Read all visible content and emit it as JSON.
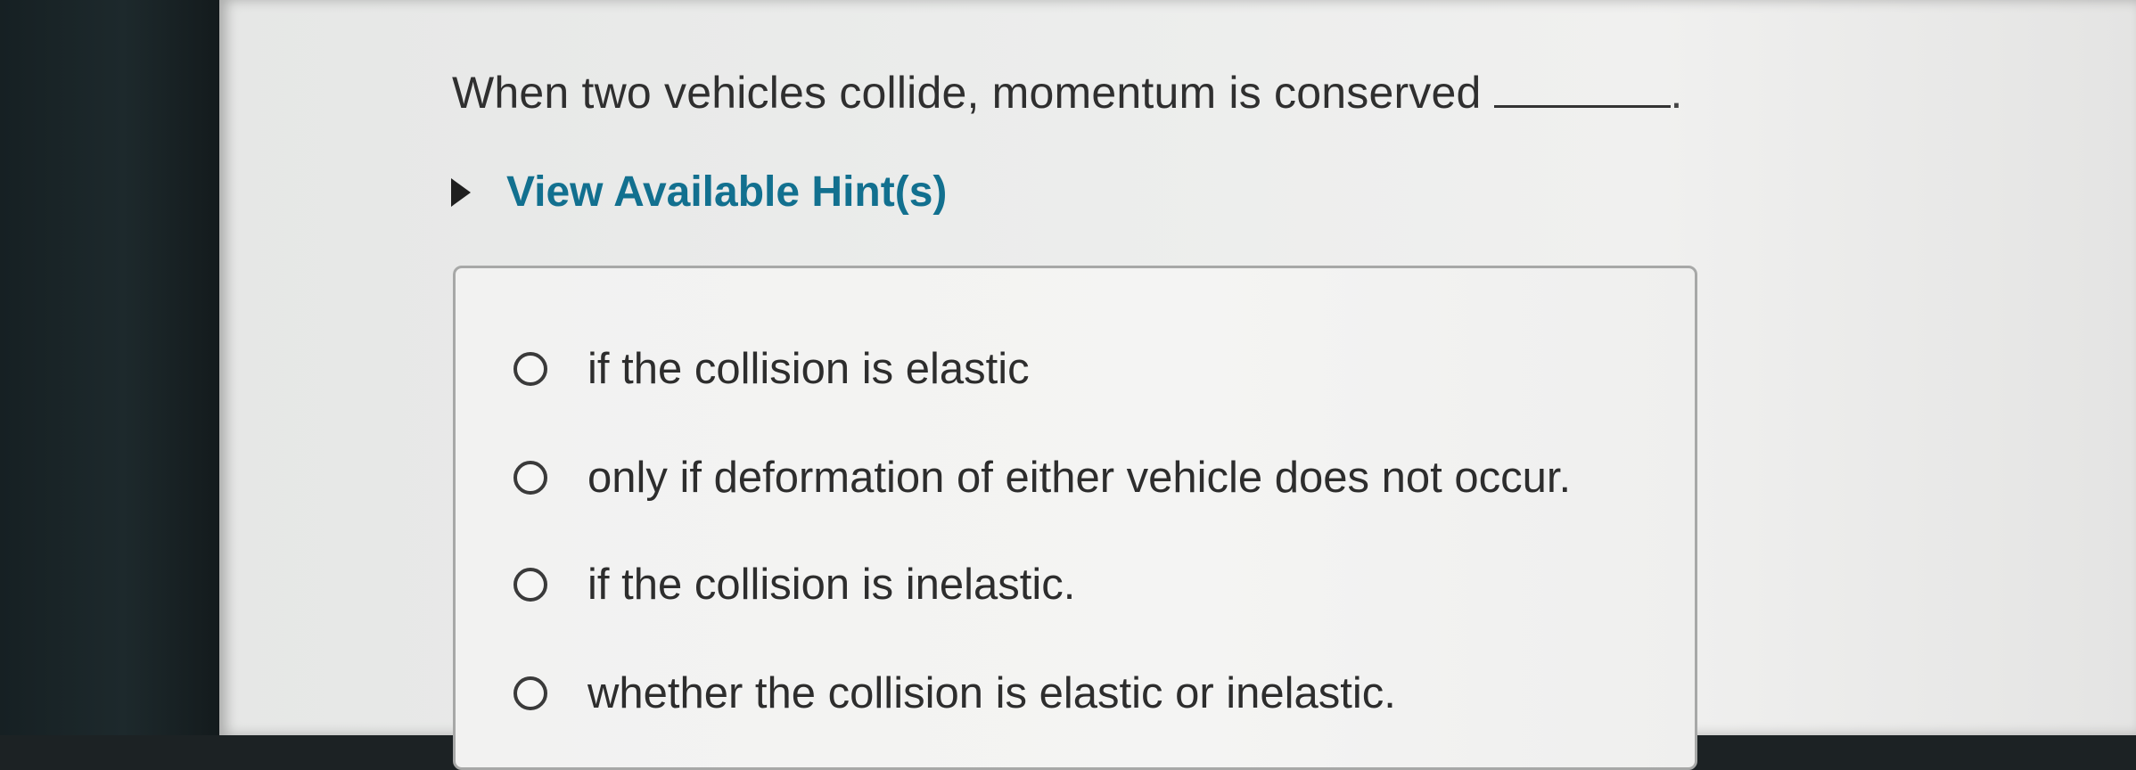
{
  "question": {
    "text": "When two vehicles collide, momentum is conserved",
    "end_punctuation": "."
  },
  "hint": {
    "label": "View Available Hint(s)"
  },
  "options": [
    {
      "label": "if the collision is elastic"
    },
    {
      "label": "only if deformation of either vehicle does not occur."
    },
    {
      "label": "if the collision is inelastic."
    },
    {
      "label": "whether the collision is elastic or inelastic."
    }
  ]
}
